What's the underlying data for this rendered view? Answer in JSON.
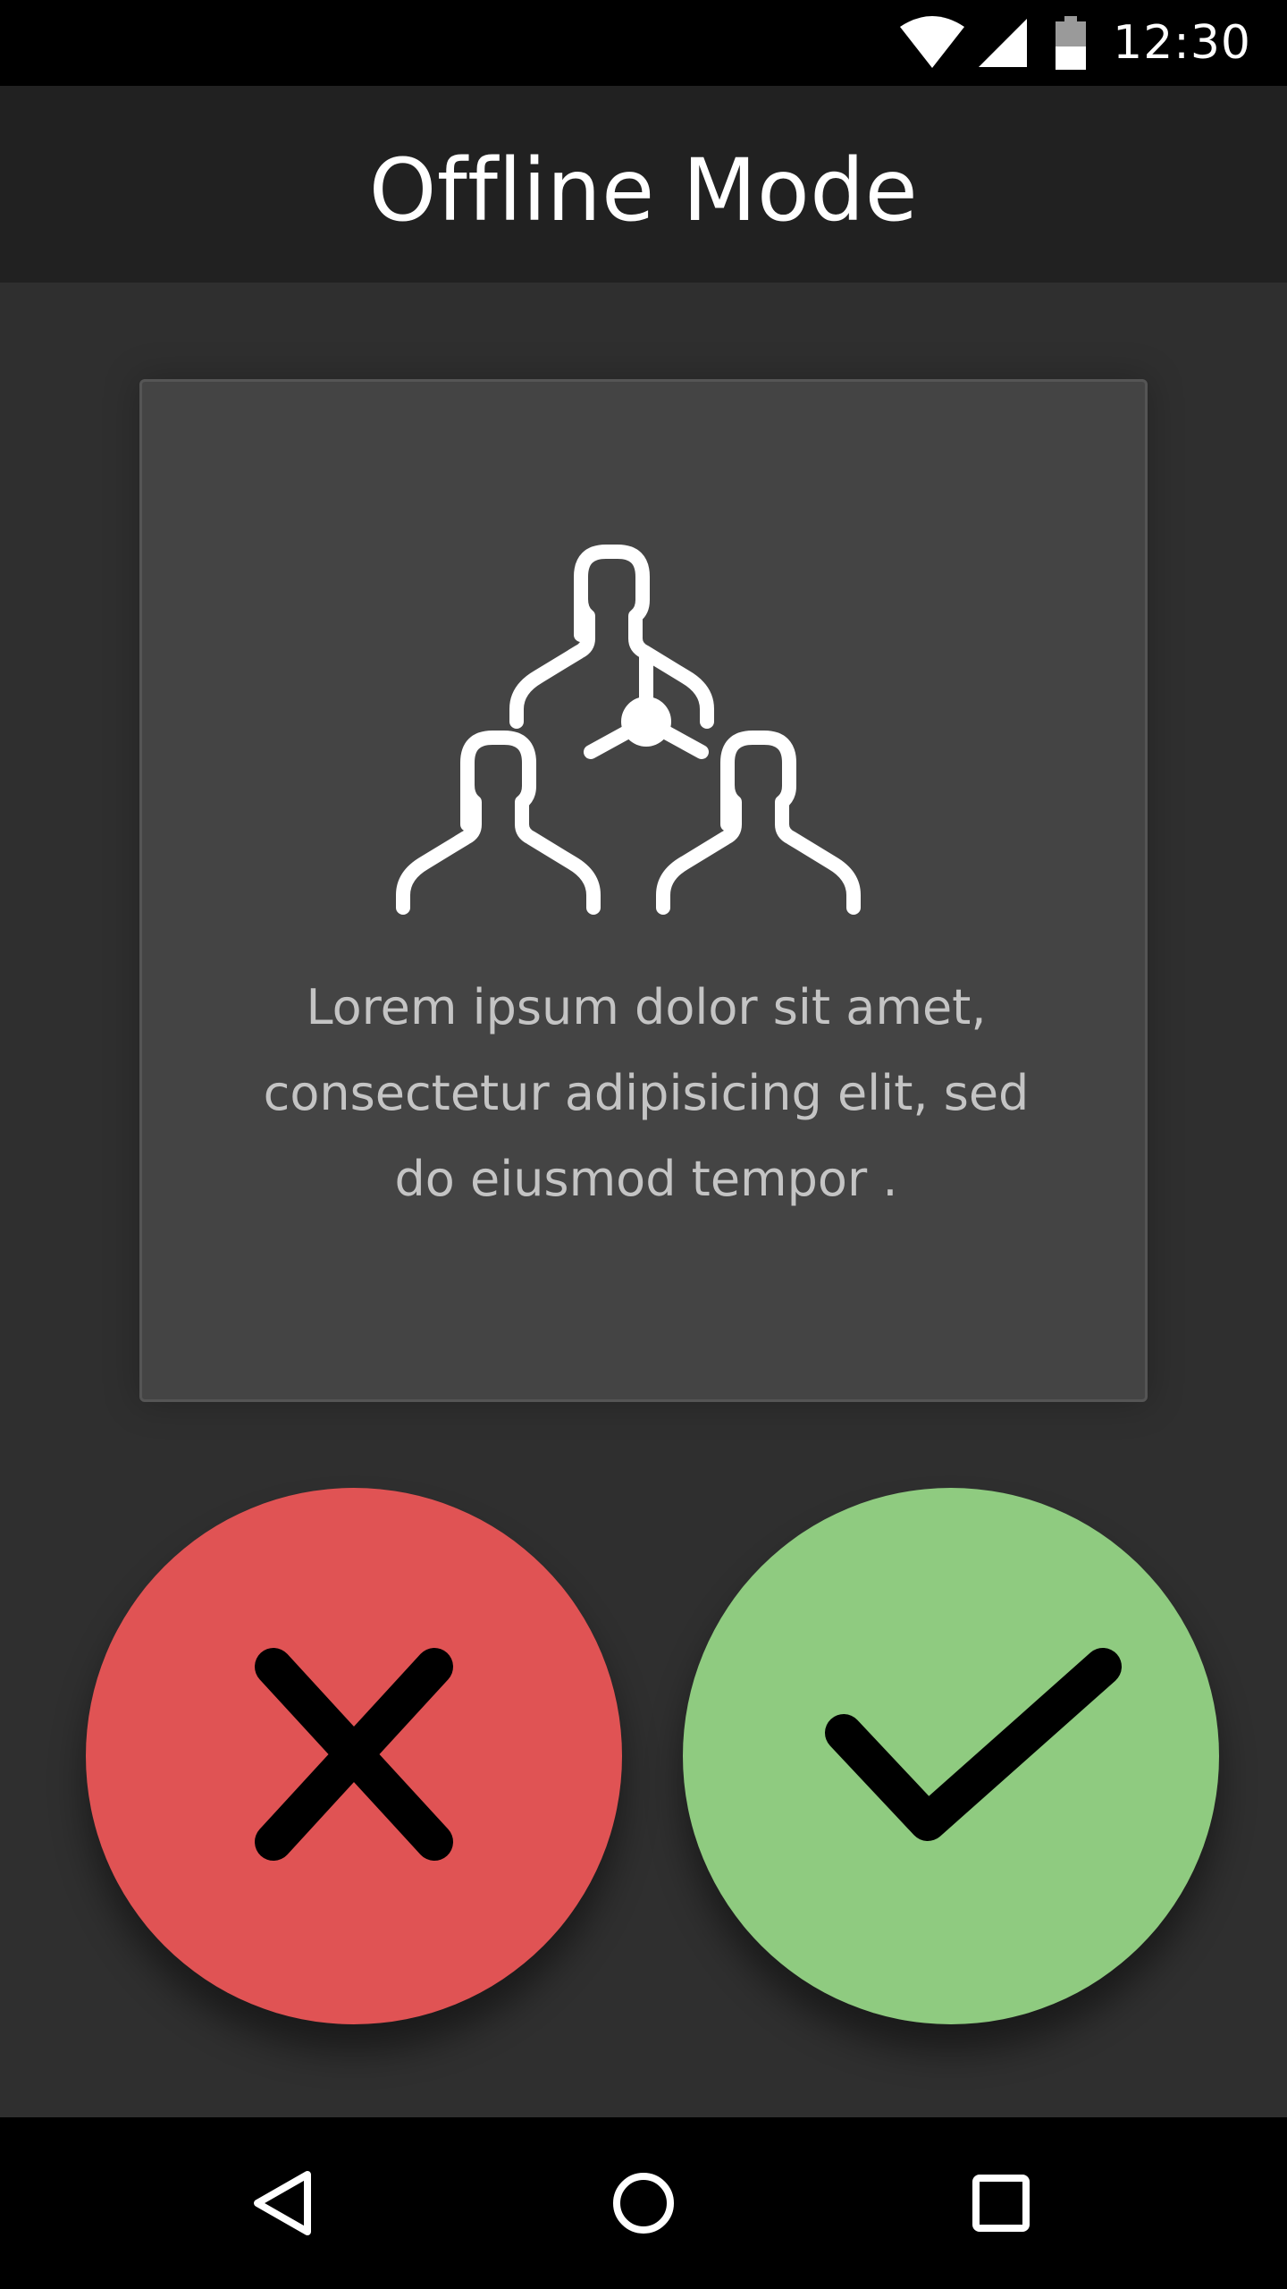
{
  "status_bar": {
    "time": "12:30",
    "icons": [
      "wifi-icon",
      "signal-icon",
      "battery-icon"
    ]
  },
  "app_bar": {
    "title": "Offline Mode"
  },
  "card": {
    "icon": "group-network-icon",
    "lines": [
      "Lorem ipsum dolor sit amet,",
      "consectetur adipisicing elit, sed",
      "do eiusmod tempor ."
    ]
  },
  "actions": {
    "reject": {
      "icon": "close-icon",
      "color": "#e05354"
    },
    "accept": {
      "icon": "check-icon",
      "color": "#8fcb80"
    }
  },
  "nav_bar": {
    "buttons": [
      "back-icon",
      "home-icon",
      "recents-icon"
    ]
  },
  "colors": {
    "background": "#2f2f2f",
    "app_bar": "#212121",
    "card": "#444444",
    "text_secondary": "#c4c4c4"
  }
}
